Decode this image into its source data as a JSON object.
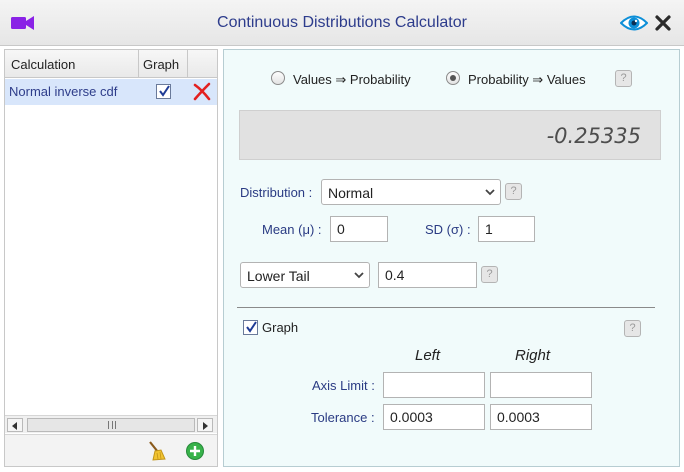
{
  "window": {
    "title": "Continuous Distributions Calculator",
    "icons": [
      "video-camera-icon",
      "eye-icon",
      "close-icon"
    ],
    "accent_color": "#8a22e6"
  },
  "calc_list": {
    "headers": {
      "calculation": "Calculation",
      "graph": "Graph"
    },
    "rows": [
      {
        "name": "Normal inverse cdf",
        "graph_checked": true,
        "selected": true
      }
    ],
    "footer_icons": [
      "broom-icon",
      "add-icon"
    ]
  },
  "mode": {
    "options": [
      {
        "label": "Values ⇒ Probability",
        "checked": false
      },
      {
        "label": "Probability ⇒ Values",
        "checked": true
      }
    ],
    "help": "?"
  },
  "result": {
    "value": "-0.25335"
  },
  "distribution": {
    "label": "Distribution :",
    "value": "Normal",
    "help": "?"
  },
  "parameters": {
    "mean_label": "Mean (μ) :",
    "mean_value": "0",
    "sd_label": "SD (σ) :",
    "sd_value": "1"
  },
  "tail": {
    "value": "Lower Tail",
    "probability": "0.4",
    "help": "?"
  },
  "graph": {
    "label": "Graph",
    "checked": true,
    "help": "?",
    "left_label": "Left",
    "right_label": "Right",
    "axis_limit_label": "Axis Limit :",
    "axis_limit_left": "",
    "axis_limit_right": "",
    "tolerance_label": "Tolerance :",
    "tolerance_left": "0.0003",
    "tolerance_right": "0.0003"
  }
}
